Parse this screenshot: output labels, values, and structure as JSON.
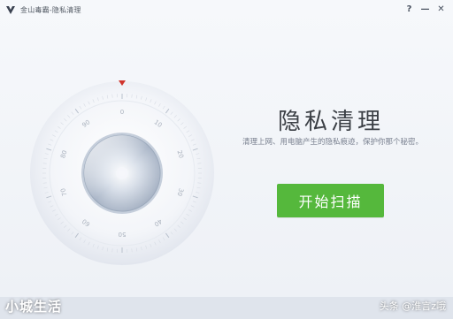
{
  "window": {
    "title": "金山毒霸-隐私清理",
    "controls": {
      "help_icon": "?",
      "minimize_icon": "—",
      "close_icon": "✕"
    }
  },
  "dial": {
    "ticks": [
      "0",
      "10",
      "20",
      "30",
      "40",
      "50",
      "60",
      "70",
      "80",
      "90"
    ],
    "accent": "#d0342c"
  },
  "main": {
    "title": "隐私清理",
    "subtitle": "清理上网、用电脑产生的隐私痕迹，保护你那个秘密。",
    "scan_button_label": "开始扫描",
    "button_color": "#55b83c"
  },
  "watermark": {
    "left": "小城生活",
    "right": "头条 @淮言z哦"
  }
}
